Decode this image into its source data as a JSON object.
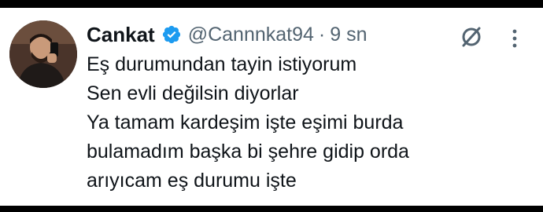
{
  "author": {
    "name": "Cankat",
    "handle": "@Cannnkat94",
    "separator": "·",
    "time": "9 sn",
    "verified": true
  },
  "tweet": {
    "lines": [
      "Eş durumundan tayin istiyorum",
      "Sen evli değilsin diyorlar",
      "Ya tamam kardeşim işte eşimi burda",
      "bulamadım başka bi şehre gidip orda",
      "arıyıcam eş durumu işte"
    ]
  },
  "icons": {
    "verified": "verified-badge-icon",
    "grok": "grok-icon",
    "more": "more-vertical-icon"
  },
  "colors": {
    "text": "#0f1419",
    "muted": "#536471",
    "verified": "#1d9bf0",
    "background": "#ffffff"
  }
}
